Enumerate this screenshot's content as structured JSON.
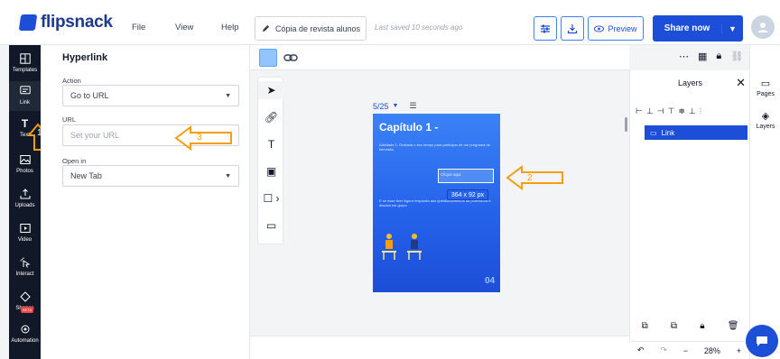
{
  "app": {
    "logo": "flipsnack"
  },
  "menu": {
    "file": "File",
    "view": "View",
    "help": "Help"
  },
  "doc": {
    "title": "Cópia de revista alunos",
    "saved": "Last saved 10 seconds ago"
  },
  "toolbar": {
    "preview": "Preview",
    "share": "Share now"
  },
  "sidebar": {
    "items": [
      {
        "label": "Templates",
        "icon": "templates-icon"
      },
      {
        "label": "Link",
        "icon": "link-icon"
      },
      {
        "label": "Text",
        "icon": "text-icon"
      },
      {
        "label": "Photos",
        "icon": "photos-icon"
      },
      {
        "label": "Uploads",
        "icon": "uploads-icon"
      },
      {
        "label": "Video",
        "icon": "video-icon"
      },
      {
        "label": "Interact",
        "icon": "interact-icon"
      },
      {
        "label": "Shapes",
        "icon": "shapes-icon"
      },
      {
        "label": "Automation",
        "icon": "automation-icon"
      }
    ],
    "beta": "BETA"
  },
  "hyperlink": {
    "title": "Hyperlink",
    "action_label": "Action",
    "action_value": "Go to URL",
    "url_label": "URL",
    "url_placeholder": "Set your URL",
    "open_label": "Open in",
    "open_value": "New Tab"
  },
  "canvas": {
    "page_indicator": "5/25",
    "page_title": "Capítulo 1 -",
    "para1": "Atividade 1: Gostaria o seu tempo para participar de um programa de televisão.",
    "selection_text": "Clique aqui",
    "para2": "E se esse tiver Agora responda aos questionamentos da professora e discuta em grupo",
    "dimensions": "364 x 92 px",
    "page_number": "04"
  },
  "annotations": {
    "one": "1",
    "two": "2",
    "three": "3"
  },
  "layers": {
    "title": "Layers",
    "item": "Link",
    "zoom": "28%"
  },
  "rail": {
    "pages": "Pages",
    "layers": "Layers"
  },
  "colors": {
    "accent": "#1d4ed8",
    "annotation": "#f59e0b",
    "page": "#2563eb"
  }
}
